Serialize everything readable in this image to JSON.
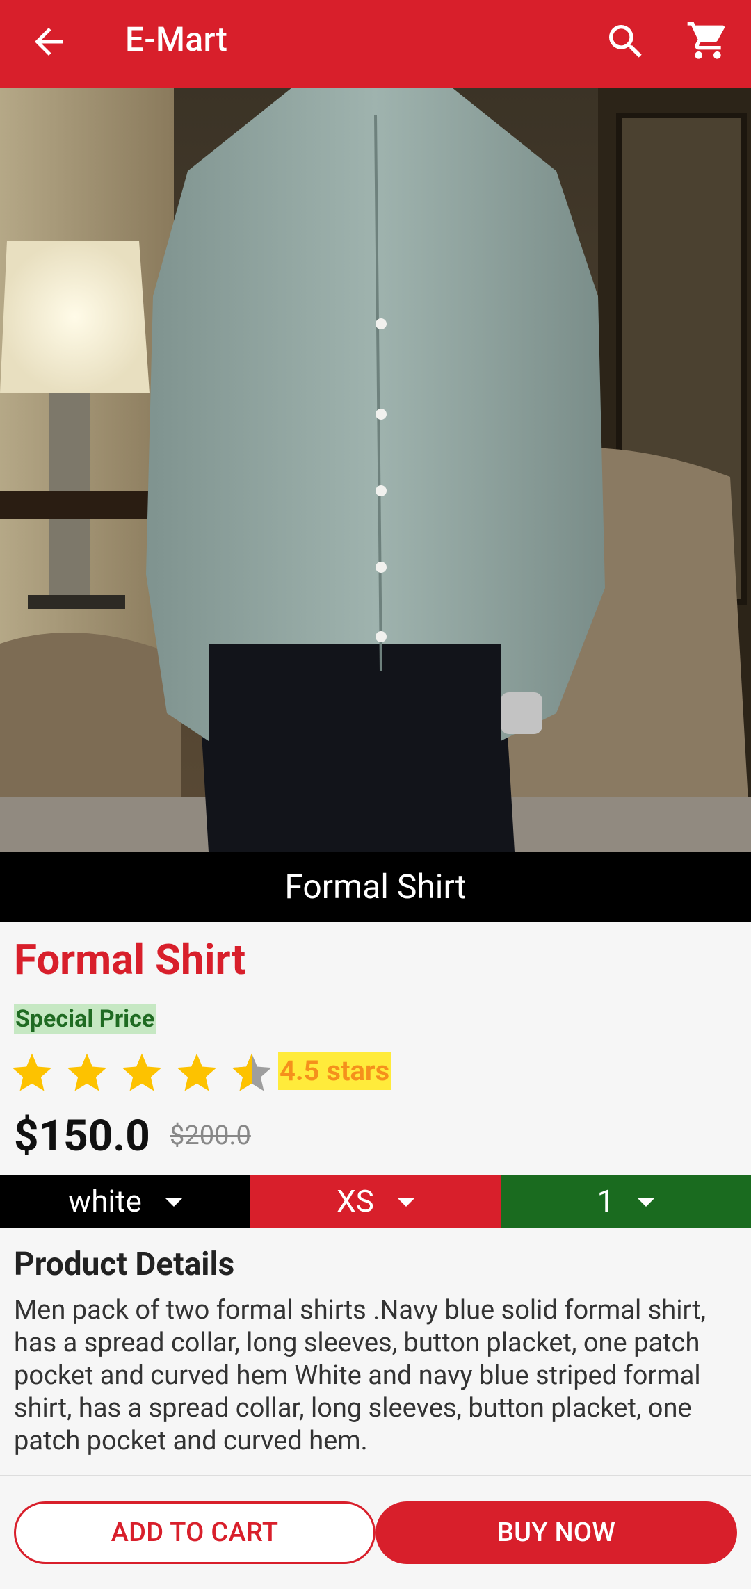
{
  "appbar": {
    "title": "E-Mart",
    "icons": [
      "back-arrow-icon",
      "search-icon",
      "cart-icon"
    ]
  },
  "product": {
    "image_caption": "Formal Shirt",
    "name": "Formal Shirt",
    "badge": "Special Price",
    "rating_value": 4.5,
    "rating_max": 5,
    "rating_label": "4.5 stars",
    "price": "$150.0",
    "original_price": "$200.0"
  },
  "selectors": {
    "color": "white",
    "size": "XS",
    "quantity": "1"
  },
  "details": {
    "title": "Product Details",
    "text": "Men pack of two formal shirts .Navy blue solid formal shirt, has a spread collar, long sleeves, button placket, one patch pocket and curved hem White and navy blue striped formal shirt, has a spread collar, long sleeves, button placket, one patch pocket and curved hem."
  },
  "actions": {
    "add_to_cart": "ADD TO CART",
    "buy_now": "BUY NOW"
  },
  "colors": {
    "brand_red": "#d81f2b",
    "star_yellow": "#fdc200",
    "special_green": "#1f6b22",
    "qty_green": "#1a6b1f"
  }
}
